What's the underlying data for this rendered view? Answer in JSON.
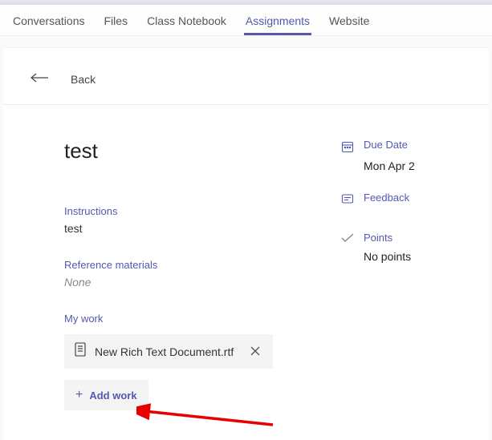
{
  "tabs": [
    {
      "label": "Conversations",
      "active": false
    },
    {
      "label": "Files",
      "active": false
    },
    {
      "label": "Class Notebook",
      "active": false
    },
    {
      "label": "Assignments",
      "active": true
    },
    {
      "label": "Website",
      "active": false
    }
  ],
  "back": {
    "label": "Back"
  },
  "assignment": {
    "title": "test",
    "instructions_label": "Instructions",
    "instructions_value": "test",
    "reference_label": "Reference materials",
    "reference_value": "None",
    "mywork_label": "My work",
    "mywork_items": [
      {
        "name": "New Rich Text Document.rtf"
      }
    ],
    "add_work_label": "Add work"
  },
  "side": {
    "due_label": "Due Date",
    "due_value": "Mon Apr 2",
    "feedback_label": "Feedback",
    "points_label": "Points",
    "points_value": "No points"
  }
}
